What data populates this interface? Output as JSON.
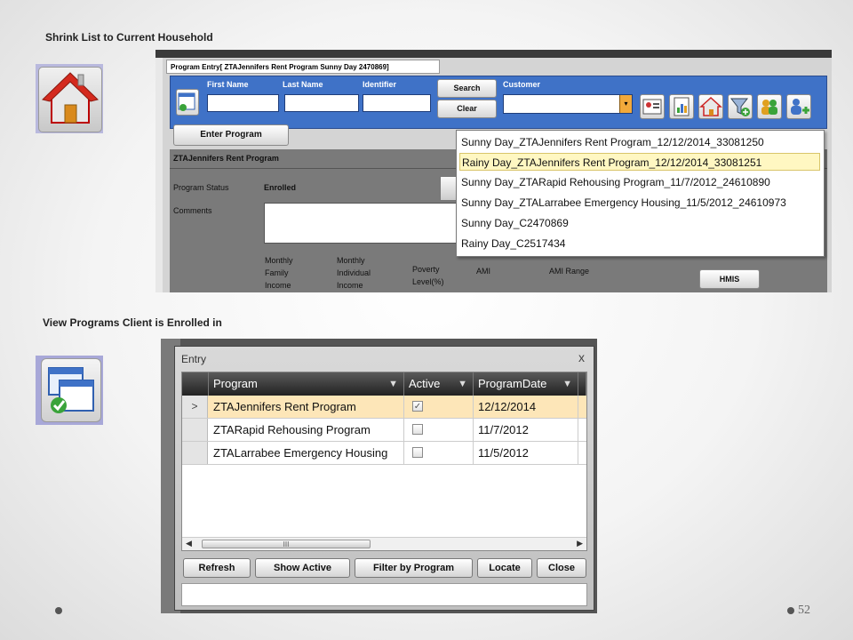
{
  "headings": {
    "shrink": "Shrink List to Current Household",
    "view": "View Programs Client is Enrolled in"
  },
  "top_window": {
    "tab_title": "Program Entry[ ZTAJennifers Rent Program Sunny Day 2470869]",
    "labels": {
      "first_name": "First Name",
      "last_name": "Last Name",
      "identifier": "Identifier",
      "customer": "Customer"
    },
    "buttons": {
      "search": "Search",
      "clear": "Clear",
      "enter_program": "Enter Program",
      "hmis": "HMIS"
    },
    "section_title": "ZTAJennifers Rent Program",
    "program_status_label": "Program Status",
    "program_status_value": "Enrolled",
    "comments_label": "Comments",
    "columns": {
      "monthly_family_income": [
        "Monthly",
        "Family",
        "Income"
      ],
      "monthly_individual_income": [
        "Monthly",
        "Individual",
        "Income"
      ],
      "poverty_level": [
        "Poverty",
        "Level(%)"
      ],
      "ami": "AMI",
      "ami_range": "AMI Range"
    },
    "dropdown_items": [
      "Sunny  Day_ZTAJennifers Rent Program_12/12/2014_33081250",
      "Rainy  Day_ZTAJennifers Rent Program_12/12/2014_33081251",
      "Sunny  Day_ZTARapid Rehousing Program_11/7/2012_24610890",
      "Sunny  Day_ZTALarrabee Emergency Housing_11/5/2012_24610973",
      "Sunny  Day_C2470869",
      "Rainy  Day_C2517434"
    ],
    "selected_index": 1,
    "toolbar_icons": [
      "id-card-icon",
      "report-icon",
      "home-icon",
      "filter-icon",
      "group-icon",
      "add-person-icon"
    ]
  },
  "entry_dialog": {
    "title": "Entry",
    "close": "x",
    "headers": {
      "program": "Program",
      "active": "Active",
      "program_date": "ProgramDate"
    },
    "rows": [
      {
        "marker": ">",
        "program": "ZTAJennifers Rent Program",
        "active": true,
        "date": "12/12/2014"
      },
      {
        "marker": "",
        "program": "ZTARapid Rehousing Program",
        "active": false,
        "date": "11/7/2012"
      },
      {
        "marker": "",
        "program": "ZTALarrabee Emergency Housing",
        "active": false,
        "date": "11/5/2012"
      }
    ],
    "buttons": {
      "refresh": "Refresh",
      "show_active": "Show Active",
      "filter_by_program": "Filter by Program",
      "locate": "Locate",
      "close": "Close"
    },
    "scroll_thumb": "III"
  },
  "page_number": "52",
  "colors": {
    "toolbar_blue": "#3f72c7",
    "selected_row": "#fff7c2",
    "grid_selected": "#fde6b8"
  }
}
